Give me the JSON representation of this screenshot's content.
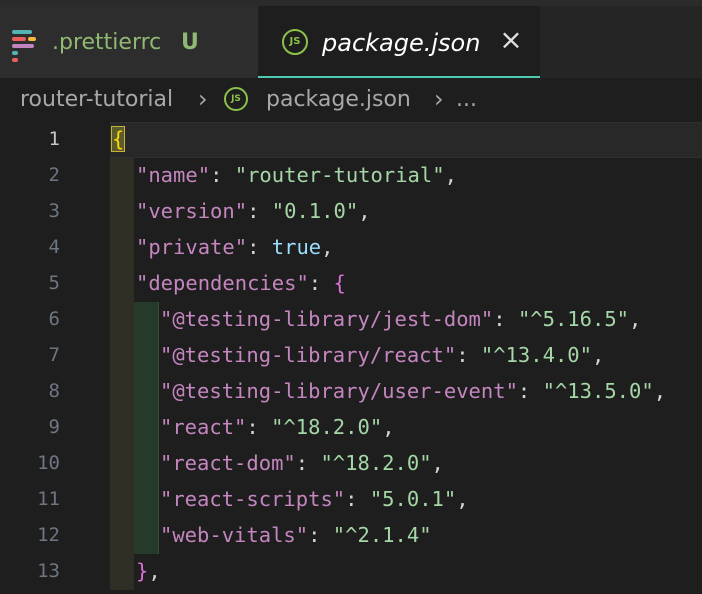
{
  "tabs": [
    {
      "label": ".prettierrc",
      "status": "U",
      "icon": "prettier-icon",
      "active": false
    },
    {
      "label": "package.json",
      "icon": "js-icon",
      "active": true
    }
  ],
  "breadcrumb": {
    "folder": "router-tutorial",
    "file": "package.json",
    "more": "..."
  },
  "editor": {
    "lines": [
      {
        "n": "1"
      },
      {
        "n": "2"
      },
      {
        "n": "3"
      },
      {
        "n": "4"
      },
      {
        "n": "5"
      },
      {
        "n": "6"
      },
      {
        "n": "7"
      },
      {
        "n": "8"
      },
      {
        "n": "9"
      },
      {
        "n": "10"
      },
      {
        "n": "11"
      },
      {
        "n": "12"
      },
      {
        "n": "13"
      }
    ],
    "tokens": {
      "l1_brace": "{",
      "l2_key": "\"name\"",
      "l2_val": "\"router-tutorial\"",
      "l3_key": "\"version\"",
      "l3_val": "\"0.1.0\"",
      "l4_key": "\"private\"",
      "l4_val": "true",
      "l5_key": "\"dependencies\"",
      "l5_brace": "{",
      "l6_key": "\"@testing-library/jest-dom\"",
      "l6_val": "\"^5.16.5\"",
      "l7_key": "\"@testing-library/react\"",
      "l7_val": "\"^13.4.0\"",
      "l8_key": "\"@testing-library/user-event\"",
      "l8_val": "\"^13.5.0\"",
      "l9_key": "\"react\"",
      "l9_val": "\"^18.2.0\"",
      "l10_key": "\"react-dom\"",
      "l10_val": "\"^18.2.0\"",
      "l11_key": "\"react-scripts\"",
      "l11_val": "\"5.0.1\"",
      "l12_key": "\"web-vitals\"",
      "l12_val": "\"^2.1.4\"",
      "l13_close": "}"
    }
  },
  "colors": {
    "key": "#c586c0",
    "string": "#a5d6a7",
    "bool": "#9cdcfe",
    "untracked": "#8fb872",
    "tab_accent": "#4ec9b0"
  }
}
